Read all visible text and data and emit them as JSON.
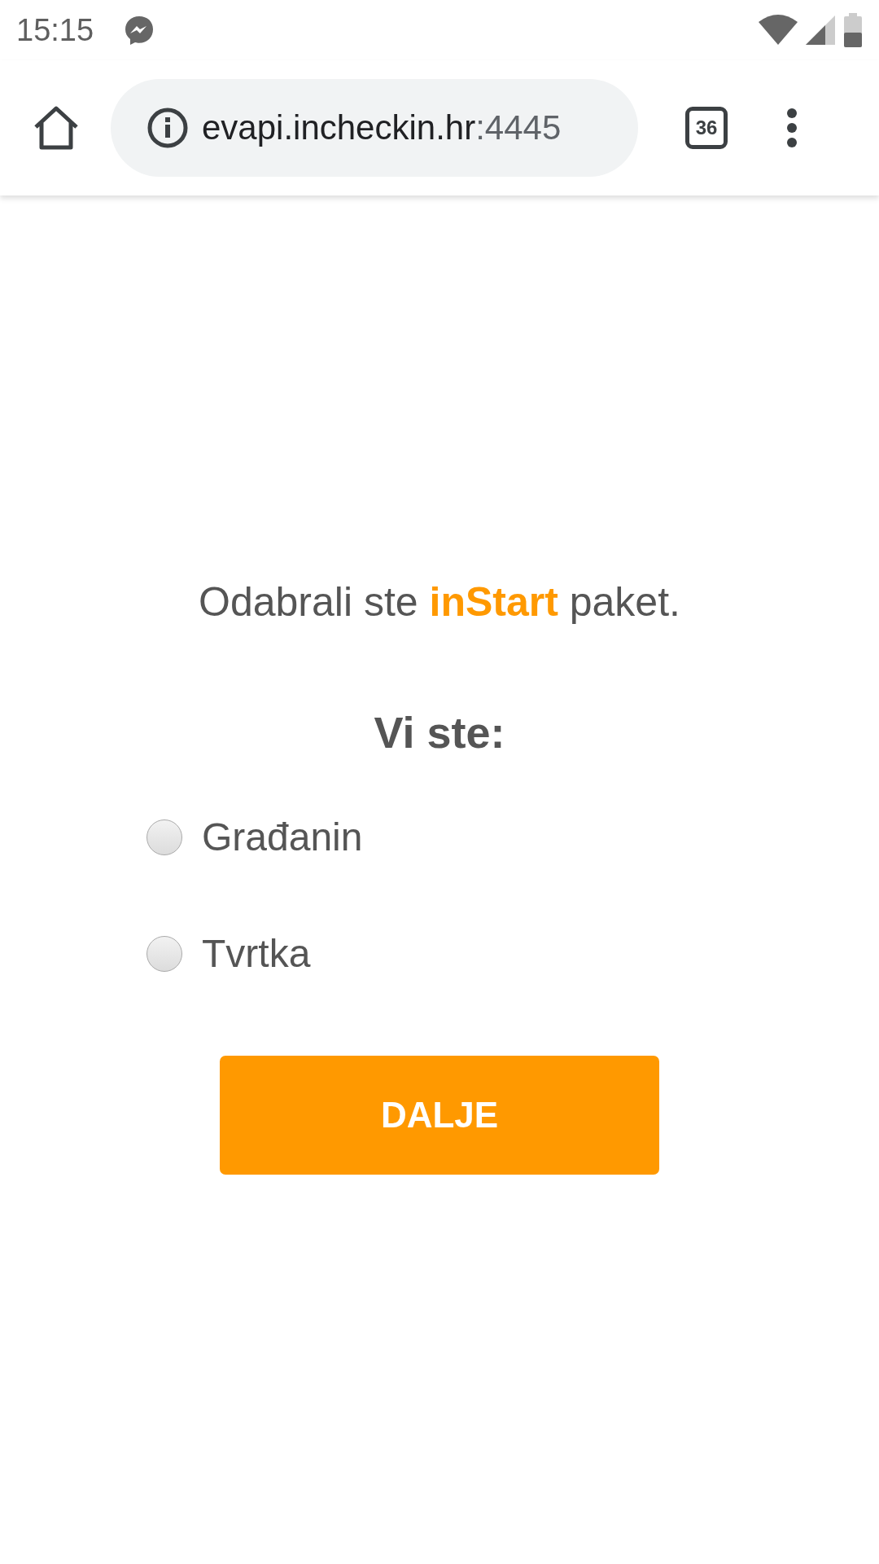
{
  "status_bar": {
    "time": "15:15"
  },
  "toolbar": {
    "url_host": "evapi.incheckin.hr",
    "url_port": ":4445",
    "tab_count": "36"
  },
  "content": {
    "message": "Odabrali ste **inStart** paket.",
    "question": "Vi ste:",
    "options": [
      {
        "label": "Građanin",
        "selected": false
      },
      {
        "label": "Tvrtka",
        "selected": false
      }
    ],
    "button": "DALJE"
  }
}
